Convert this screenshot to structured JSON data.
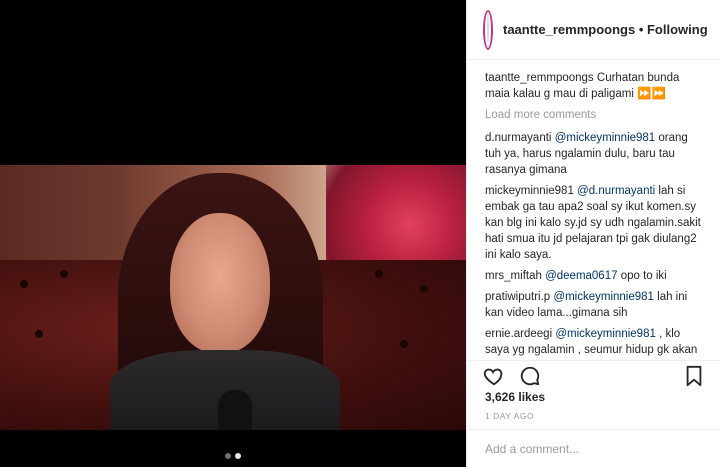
{
  "post": {
    "username": "taantte_remmpoongs",
    "separator": " • ",
    "follow_label": "Following",
    "caption_user": "taantte_remmpoongs",
    "caption_text": " Curhatan bunda maia kalau g mau di paligami ",
    "caption_emoji": "⏩⏩",
    "load_more_label": "Load more comments",
    "comments": [
      {
        "user": "d.nurmayanti",
        "mention": "@mickeyminnie981",
        "text": " orang tuh ya, harus ngalamin dulu, baru tau rasanya gimana"
      },
      {
        "user": "mickeyminnie981",
        "mention": "@d.nurmayanti",
        "text": " lah si embak ga tau apa2 soal sy ikut komen.sy kan blg ini kalo sy.jd sy udh ngalamin.sakit hati smua itu jd pelajaran tpi gak diulang2 ini kalo saya."
      },
      {
        "user": "mrs_miftah",
        "mention": "@deema0617",
        "text": " opo to iki"
      },
      {
        "user": "pratiwiputri.p",
        "mention": "@mickeyminnie981",
        "text": " lah ini kan video lama...gimana sih"
      },
      {
        "user": "ernie.ardeegi",
        "mention": "@mickeyminnie981",
        "text": " , klo saya yg ngalamin , seumur hidup gk akan pernah bisa lupa dan gk akan pernah saya lupakan😂😂"
      }
    ],
    "likes": "3,626 likes",
    "time_ago": "1 DAY AGO",
    "add_comment_placeholder": "Add a comment..."
  },
  "icons": {
    "like": "heart-icon",
    "comment": "comment-icon",
    "save": "bookmark-icon"
  },
  "carousel": {
    "count": 2,
    "active": 2
  }
}
